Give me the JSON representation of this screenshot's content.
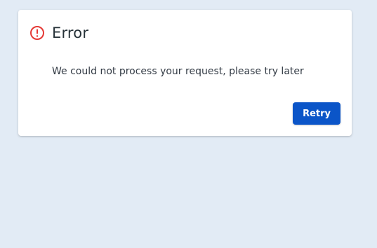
{
  "dialog": {
    "icon": "error-icon",
    "title": "Error",
    "message": "We could not process your request, please try later",
    "retry_label": "Retry"
  },
  "colors": {
    "background": "#e2ebf5",
    "dialog_background": "#ffffff",
    "error_icon": "#e53935",
    "primary_button": "#0b55c8",
    "title_text": "#263238",
    "message_text": "#333b45"
  }
}
